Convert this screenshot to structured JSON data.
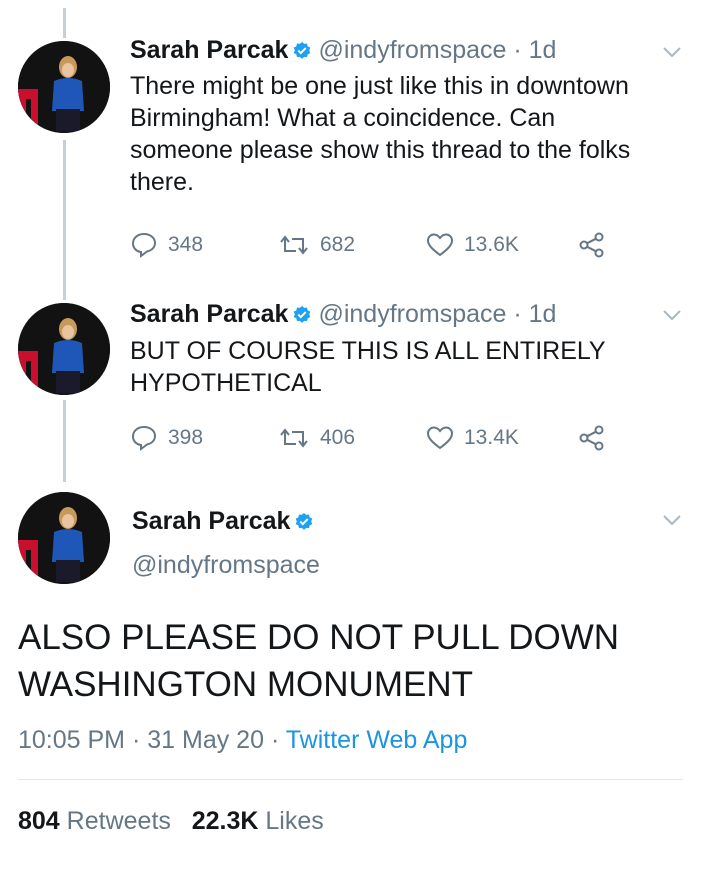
{
  "tweets": [
    {
      "name": "Sarah Parcak",
      "handle": "@indyfromspace",
      "time": "· 1d",
      "lines": [
        "There might be one just like this in downtown",
        "Birmingham! What a coincidence. Can",
        "someone please show this thread to the folks",
        "there."
      ],
      "replies": "348",
      "retweets": "682",
      "likes": "13.6K"
    },
    {
      "name": "Sarah Parcak",
      "handle": "@indyfromspace",
      "time": "· 1d",
      "lines": [
        "BUT OF COURSE THIS IS ALL ENTIRELY",
        "HYPOTHETICAL"
      ],
      "replies": "398",
      "retweets": "406",
      "likes": "13.4K"
    }
  ],
  "main_tweet": {
    "name": "Sarah Parcak",
    "handle": "@indyfromspace",
    "lines": [
      "ALSO PLEASE DO NOT PULL DOWN",
      "WASHINGTON MONUMENT"
    ],
    "time": "10:05 PM",
    "date": "31 May 20",
    "app": "Twitter Web App",
    "retweet_count": "804",
    "retweet_label": "Retweets",
    "like_count": "22.3K",
    "like_label": "Likes"
  },
  "colors": {
    "accent": "#1b95e0",
    "secondary_text": "#657786",
    "verified": "#1da1f2"
  },
  "icons": [
    "verified-badge-icon",
    "chevron-down-icon",
    "reply-icon",
    "retweet-icon",
    "like-icon",
    "share-icon"
  ]
}
